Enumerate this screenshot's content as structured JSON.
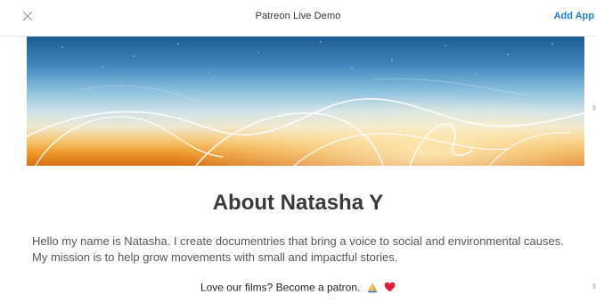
{
  "window": {
    "title": "Patreon Live Demo",
    "add_app_label": "Add App"
  },
  "about": {
    "heading": "About Natasha Y",
    "bio": "Hello my name is Natasha. I create documentries that bring a voice to social and environmental causes. My mission is to help grow movements with small and impactful stories.",
    "cta": "Love our films? Become a patron."
  },
  "icons": {
    "close": "close-icon",
    "praying_hands": "praying-hands-icon",
    "heart": "heart-icon"
  },
  "colors": {
    "accent": "#1f7fd6",
    "heart": "#e0203a"
  }
}
